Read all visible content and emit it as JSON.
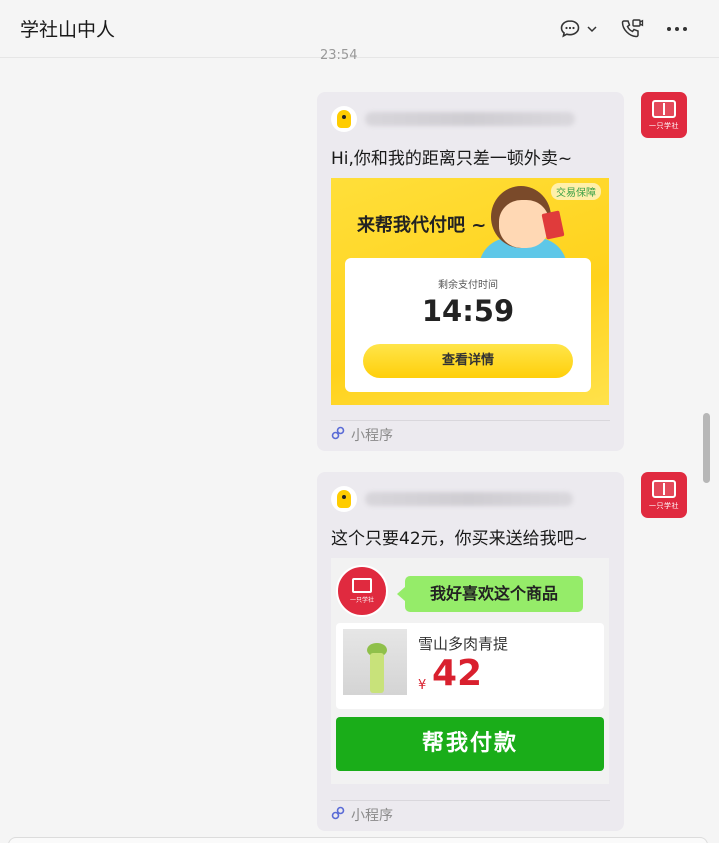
{
  "header": {
    "title": "学社山中人"
  },
  "chat": {
    "timestamp": "23:54",
    "sender_avatar_label": "一只学社",
    "messages": [
      {
        "text": "Hi,你和我的距离只差一顿外卖~",
        "image": {
          "badge": "交易保障",
          "headline": "来帮我代付吧 ~",
          "panel_title": "剩余支付时间",
          "countdown": "14:59",
          "button": "查看详情"
        },
        "footer": "小程序"
      },
      {
        "text": "这个只要42元，你买来送给我吧~",
        "image": {
          "shop_label": "一只学社",
          "speech": "我好喜欢这个商品",
          "product_name": "雪山多肉青提",
          "currency": "¥",
          "price": "42",
          "pay_button": "帮我付款"
        },
        "footer": "小程序"
      }
    ]
  },
  "icons": {
    "chat": "chat-bubble-icon",
    "chevron": "chevron-down-icon",
    "call": "phone-video-icon",
    "more": "more-icon",
    "miniprogram": "miniprogram-link-icon"
  }
}
